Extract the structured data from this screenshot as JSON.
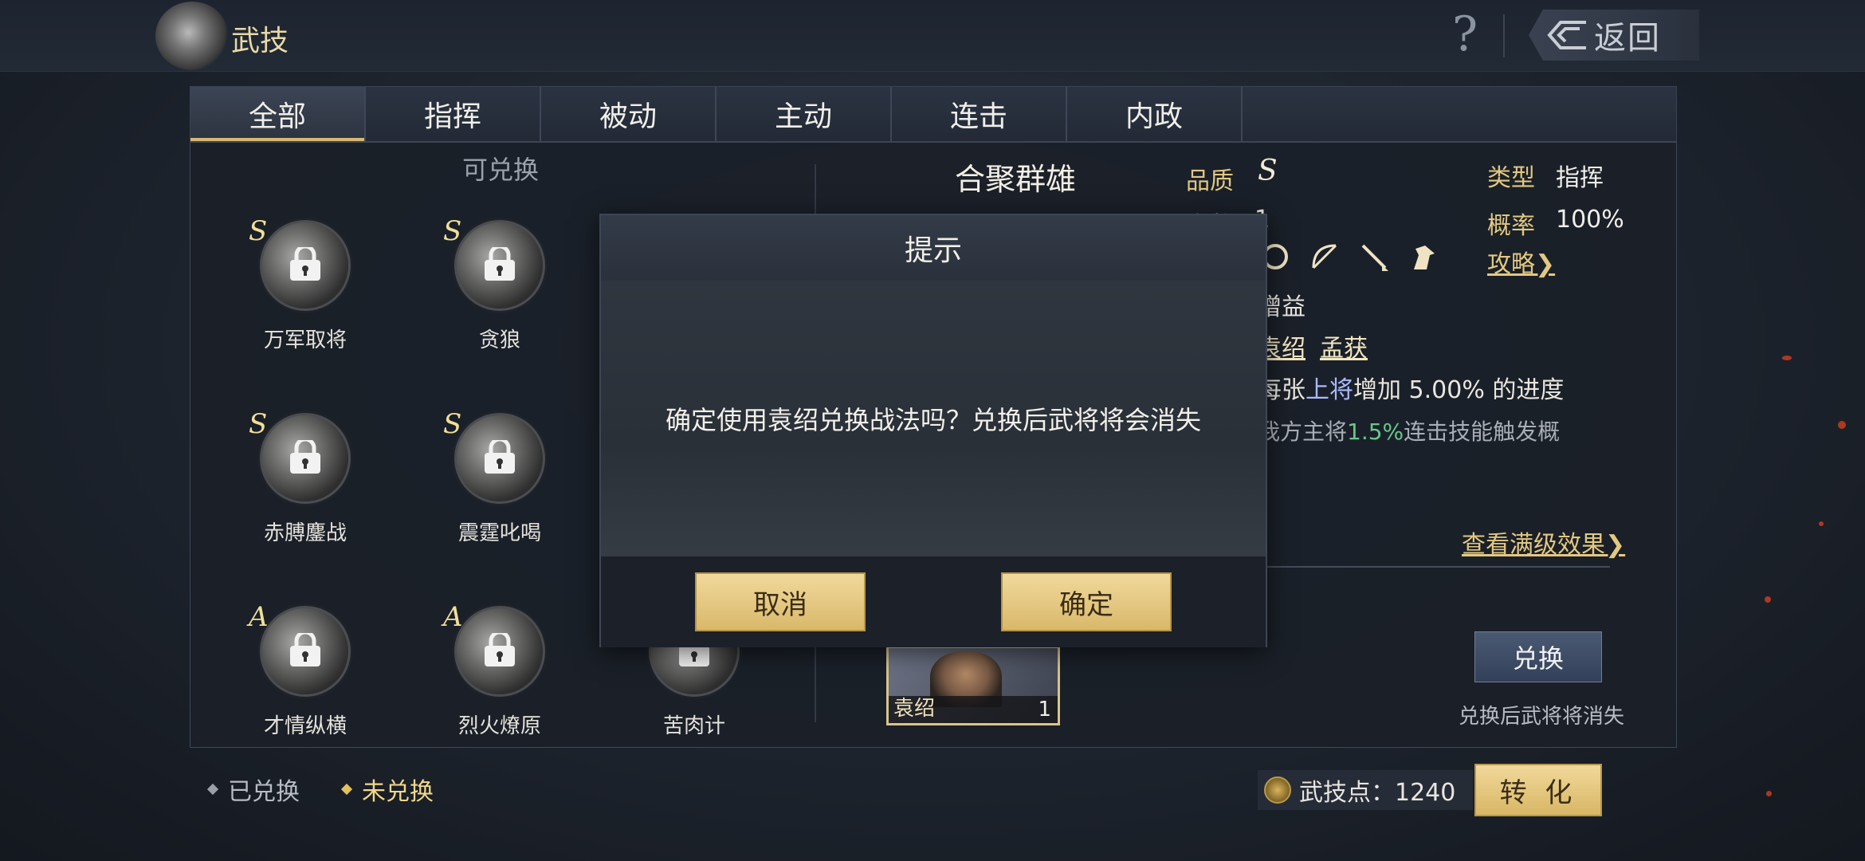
{
  "header": {
    "title": "武技",
    "help_label": "?",
    "back_label": "返回"
  },
  "tabs": [
    {
      "label": "全部",
      "active": true
    },
    {
      "label": "指挥",
      "active": false
    },
    {
      "label": "被动",
      "active": false
    },
    {
      "label": "主动",
      "active": false
    },
    {
      "label": "连击",
      "active": false
    },
    {
      "label": "内政",
      "active": false
    }
  ],
  "skill_list": {
    "heading": "可兑换",
    "items": [
      {
        "grade": "S",
        "name": "万军取将"
      },
      {
        "grade": "S",
        "name": "贪狼"
      },
      {
        "grade": "S",
        "name": "赤膊鏖战"
      },
      {
        "grade": "S",
        "name": "震霆叱喝"
      },
      {
        "grade": "A",
        "name": "才情纵横"
      },
      {
        "grade": "A",
        "name": "烈火燎原"
      },
      {
        "grade": "",
        "name": "苦肉计"
      }
    ]
  },
  "detail": {
    "title": "合聚群雄",
    "quality_label": "品质",
    "quality_value": "S",
    "count_label": "次数",
    "count_value": "1",
    "type_label": "类型",
    "type_value": "指挥",
    "rate_label": "概率",
    "rate_value": "100%",
    "guide_label": "攻略❯",
    "gain_text": "增益",
    "heroes": [
      "袁绍",
      "孟获"
    ],
    "desc1_pre": "每张",
    "desc1_hl": "上将",
    "desc1_post": "增加 5.00% 的进度",
    "desc2_pre": "我方主将",
    "desc2_hl": "1.5%",
    "desc2_post": "连击技能触发概",
    "full_effect_label": "查看满级效果❯",
    "hero_card": {
      "name": "袁绍",
      "level": "1"
    },
    "exchange_label": "兑换",
    "exchange_note": "兑换后武将将消失"
  },
  "legend": {
    "owned": "已兑换",
    "unowned": "未兑换"
  },
  "points": {
    "label": "武技点：1240",
    "convert_label": "转 化"
  },
  "modal": {
    "title": "提示",
    "message": "确定使用袁绍兑换战法吗？兑换后武将将会消失",
    "cancel_label": "取消",
    "confirm_label": "确定"
  },
  "colors": {
    "gold": "#e2c881",
    "accent_button": "#d9b86a",
    "panel_bg": "#1a1f28"
  }
}
